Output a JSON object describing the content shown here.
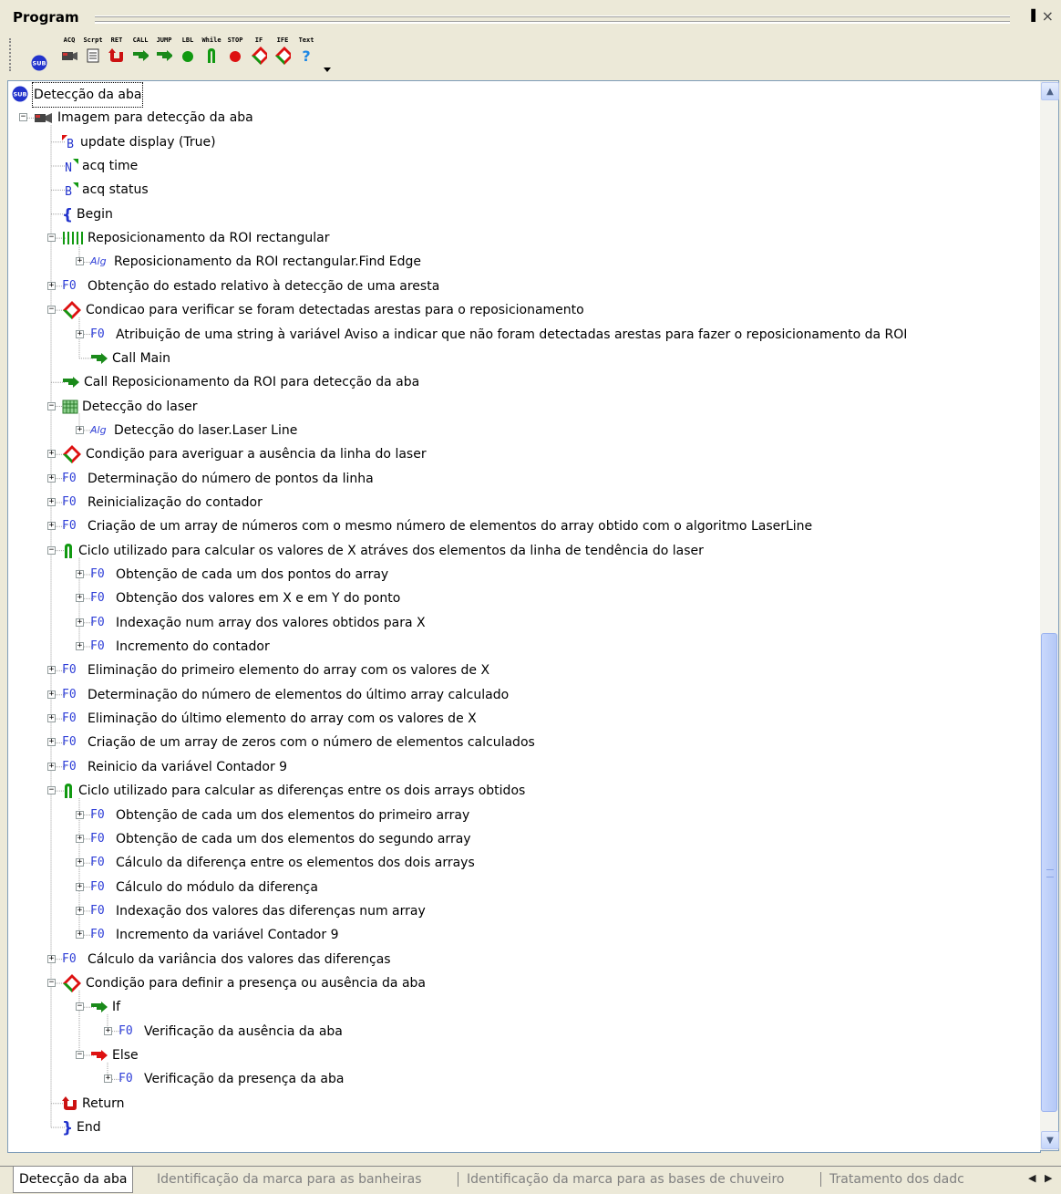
{
  "panel": {
    "title": "Program",
    "pin": "&#x2715;",
    "close": "×"
  },
  "toolbar": [
    {
      "cap": "",
      "name": "sub"
    },
    {
      "cap": "ACQ",
      "name": "acq"
    },
    {
      "cap": "Scrpt",
      "name": "script"
    },
    {
      "cap": "RET",
      "name": "ret"
    },
    {
      "cap": "CALL",
      "name": "call"
    },
    {
      "cap": "JUMP",
      "name": "jump"
    },
    {
      "cap": "LBL",
      "name": "lbl"
    },
    {
      "cap": "While",
      "name": "while"
    },
    {
      "cap": "STOP",
      "name": "stop"
    },
    {
      "cap": "IF",
      "name": "if"
    },
    {
      "cap": "IFE",
      "name": "ife"
    },
    {
      "cap": "Text",
      "name": "text"
    }
  ],
  "tree": [
    {
      "d": 0,
      "exp": "",
      "icon": "sub",
      "text": "Detecção da aba"
    },
    {
      "d": 0,
      "exp": "-",
      "icon": "acq",
      "text": "Imagem para detecção da aba"
    },
    {
      "d": 1,
      "exp": "",
      "icon": "B-red",
      "text": "update display (True)"
    },
    {
      "d": 1,
      "exp": "",
      "icon": "N-green",
      "text": "acq time"
    },
    {
      "d": 1,
      "exp": "",
      "icon": "B-green",
      "text": "acq status"
    },
    {
      "d": 1,
      "exp": "",
      "icon": "brace-open",
      "text": "Begin"
    },
    {
      "d": 1,
      "exp": "-",
      "icon": "roi",
      "text": "Reposicionamento da ROI rectangular"
    },
    {
      "d": 2,
      "exp": "+",
      "icon": "alg",
      "text": "Reposicionamento da ROI rectangular.Find Edge"
    },
    {
      "d": 1,
      "exp": "+",
      "icon": "fo",
      "text": "Obtenção do estado relativo à detecção de uma aresta"
    },
    {
      "d": 1,
      "exp": "-",
      "icon": "if",
      "text": "Condicao para verificar se foram detectadas arestas para o reposicionamento"
    },
    {
      "d": 2,
      "exp": "+",
      "icon": "fo",
      "text": "Atribuição de uma string à variável Aviso a indicar que não foram detectadas arestas para fazer o reposicionamento da ROI"
    },
    {
      "d": 2,
      "exp": "",
      "icon": "call",
      "text": "Call Main"
    },
    {
      "d": 1,
      "exp": "",
      "icon": "call",
      "text": "Call Reposicionamento da ROI para detecção da aba"
    },
    {
      "d": 1,
      "exp": "-",
      "icon": "laser",
      "text": "Detecção do laser"
    },
    {
      "d": 2,
      "exp": "+",
      "icon": "alg",
      "text": "Detecção do laser.Laser Line"
    },
    {
      "d": 1,
      "exp": "+",
      "icon": "if",
      "text": "Condição para averiguar a ausência da linha do laser"
    },
    {
      "d": 1,
      "exp": "+",
      "icon": "fo",
      "text": "Determinação do número de pontos da linha"
    },
    {
      "d": 1,
      "exp": "+",
      "icon": "fo",
      "text": "Reinicialização do contador"
    },
    {
      "d": 1,
      "exp": "+",
      "icon": "fo",
      "text": "Criação de um array de números com o mesmo número de elementos do array obtido com o algoritmo LaserLine"
    },
    {
      "d": 1,
      "exp": "-",
      "icon": "while",
      "text": "Ciclo utilizado para calcular os valores de X atráves dos elementos da linha de tendência do laser"
    },
    {
      "d": 2,
      "exp": "+",
      "icon": "fo",
      "text": "Obtenção de cada um dos pontos do array"
    },
    {
      "d": 2,
      "exp": "+",
      "icon": "fo",
      "text": "Obtenção dos valores em X e em Y do ponto"
    },
    {
      "d": 2,
      "exp": "+",
      "icon": "fo",
      "text": "Indexação num array dos valores obtidos para X"
    },
    {
      "d": 2,
      "exp": "+",
      "icon": "fo",
      "text": "Incremento do contador"
    },
    {
      "d": 1,
      "exp": "+",
      "icon": "fo",
      "text": "Eliminação do primeiro elemento do array com os valores de X"
    },
    {
      "d": 1,
      "exp": "+",
      "icon": "fo",
      "text": "Determinação do número de elementos do último array calculado"
    },
    {
      "d": 1,
      "exp": "+",
      "icon": "fo",
      "text": "Eliminação do último elemento do array com os valores de X"
    },
    {
      "d": 1,
      "exp": "+",
      "icon": "fo",
      "text": "Criação de um array de zeros com o número de elementos calculados"
    },
    {
      "d": 1,
      "exp": "+",
      "icon": "fo",
      "text": "Reinicio da variável Contador 9"
    },
    {
      "d": 1,
      "exp": "-",
      "icon": "while",
      "text": "Ciclo utilizado para calcular as diferenças entre os dois arrays obtidos"
    },
    {
      "d": 2,
      "exp": "+",
      "icon": "fo",
      "text": "Obtenção de cada um dos elementos do primeiro array"
    },
    {
      "d": 2,
      "exp": "+",
      "icon": "fo",
      "text": "Obtenção de cada um dos elementos do segundo array"
    },
    {
      "d": 2,
      "exp": "+",
      "icon": "fo",
      "text": "Cálculo da diferença entre os elementos dos dois arrays"
    },
    {
      "d": 2,
      "exp": "+",
      "icon": "fo",
      "text": "Cálculo do módulo da diferença"
    },
    {
      "d": 2,
      "exp": "+",
      "icon": "fo",
      "text": "Indexação dos valores das diferenças num array"
    },
    {
      "d": 2,
      "exp": "+",
      "icon": "fo",
      "text": "Incremento da variável Contador 9"
    },
    {
      "d": 1,
      "exp": "+",
      "icon": "fo",
      "text": "Cálculo da variância dos valores das diferenças"
    },
    {
      "d": 1,
      "exp": "-",
      "icon": "if",
      "text": "Condição para definir a presença ou ausência da aba"
    },
    {
      "d": 2,
      "exp": "-",
      "icon": "branch-green",
      "text": "If"
    },
    {
      "d": 3,
      "exp": "+",
      "icon": "fo",
      "text": "Verificação da ausência da aba"
    },
    {
      "d": 2,
      "exp": "-",
      "icon": "branch-red",
      "text": "Else"
    },
    {
      "d": 3,
      "exp": "+",
      "icon": "fo",
      "text": "Verificação da presença da aba"
    },
    {
      "d": 1,
      "exp": "",
      "icon": "return",
      "text": "Return"
    },
    {
      "d": 1,
      "exp": "",
      "icon": "brace-close",
      "text": "End"
    }
  ],
  "tabs": [
    {
      "label": "Detecção da aba",
      "active": true
    },
    {
      "label": "Identificação da marca para as banheiras",
      "active": false
    },
    {
      "label": "Identificação da marca para as bases de chuveiro",
      "active": false
    },
    {
      "label": "Tratamento dos dadc",
      "active": false
    }
  ],
  "icons": {
    "fo_text": "F0",
    "alg_text": "Alg",
    "b_text": "B",
    "n_text": "N",
    "sub_text": "SUB",
    "call_text": "CALL"
  }
}
